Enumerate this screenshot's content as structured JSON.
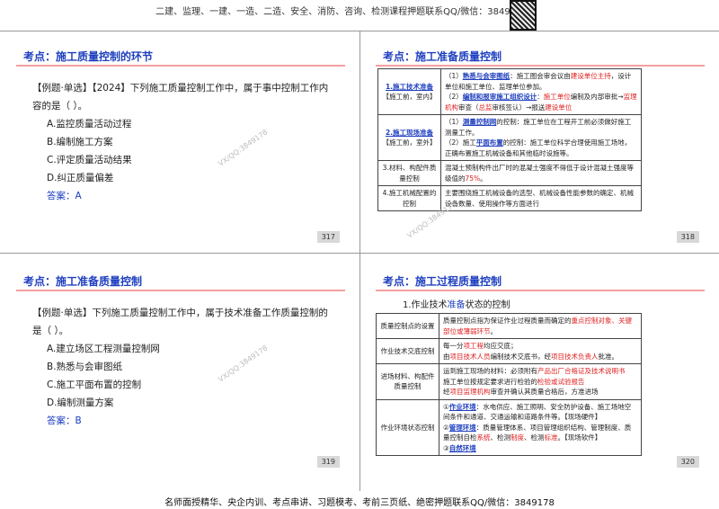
{
  "header": "二建、监理、一建、一造、二造、安全、消防、咨询、检测课程押题联系QQ/微信：3849178",
  "footer": "名师面授精华、央企内训、考点串讲、习题模考、考前三页纸、绝密押题联系QQ/微信：3849178",
  "watermark": "VX/QQ:3849178",
  "s317": {
    "title": "考点：施工质量控制的环节",
    "question": "【例题·单选】【2024】下列施工质量控制工作中，属于事中控制工作内容的是（   ）。",
    "options": [
      "A.监控质量活动过程",
      "B.编制施工方案",
      "C.评定质量活动结果",
      "D.纠正质量偏差"
    ],
    "answer": "答案：A",
    "page": "317"
  },
  "s318": {
    "title": "考点：施工准备质量控制",
    "page": "318",
    "r1h": "1.施工技术准备",
    "r1s": "【施工前，室内】",
    "r1a": "（1）",
    "r1b": "熟悉与会审图纸",
    "r1c": "：施工图会审会议由",
    "r1d": "建设单位主持",
    "r1e": "，设计单位和施工单位、监理单位参加。",
    "r1f": "（2）",
    "r1g": "编制和报审施工组织设计",
    "r1h2": "：",
    "r1i": "施工单位",
    "r1j": "编制及内部审批→",
    "r1k": "监理机构",
    "r1l": "审查（",
    "r1m": "总监",
    "r1n": "审核签认）→报送",
    "r1o": "建设单位",
    "r2h": "2.施工现场准备",
    "r2s": "【施工前，室外】",
    "r2a": "（1）",
    "r2b": "测量控制网",
    "r2c": "的控制：施工单位在工程开工前必须做好施工测量工作。",
    "r2d": "（2）施工",
    "r2e": "平面布置",
    "r2f": "的控制：施工单位科学合理使用施工场地，正确布置施工机械设备和其他临时设施等。",
    "r3h": "3.材料、构配件质量控制",
    "r3a": "混凝土预制构件出厂时的混凝土强度不得低于设计混凝土强度等级值的",
    "r3b": "75%",
    "r3c": "。",
    "r4h": "4.施工机械配置的控制",
    "r4a": "主要围绕施工机械设备的选型、机械设备性能参数的确定、机械设备数量、使用操作等方面进行"
  },
  "s319": {
    "title": "考点：施工准备质量控制",
    "question": "【例题·单选】下列施工质量控制工作中，属于技术准备工作质量控制的是（   ）。",
    "options": [
      "A.建立场区工程测量控制网",
      "B.熟悉与会审图纸",
      "C.施工平面布置的控制",
      "D.编制测量方案"
    ],
    "answer": "答案：B",
    "page": "319"
  },
  "s320": {
    "title": "考点：施工过程质量控制",
    "page": "320",
    "sub_a": "1.作业技术",
    "sub_b": "准备",
    "sub_c": "状态的控制",
    "r1h": "质量控制点的设置",
    "r1a": "质量控制点指为保证作业过程质量而确定的",
    "r1b": "重点控制对象、关键部位或薄弱环节",
    "r1c": "。",
    "r2h": "作业技术交底控制",
    "r2a": "每一分",
    "r2b": "项工程",
    "r2c": "均应交底；",
    "r2d": "由",
    "r2e": "项目技术人员",
    "r2f": "编制技术交底书，经",
    "r2g": "项目技术负责人",
    "r2h2": "批准。",
    "r3h": "进场材料、构配件质量控制",
    "r3a": "运到施工现场的材料：必须附有",
    "r3b": "产品出厂合格证及技术说明书",
    "r3c": "施工单位按规定要求进行检验的",
    "r3d": "检验或试验报告",
    "r3e": "经",
    "r3f": "项目监理机构",
    "r3g": "审查并确认其质量合格后，方准进场",
    "r4h": "作业环境状态控制",
    "r4a": "①",
    "r4b": "作业环境",
    "r4c": "：水电供应、施工照明、安全防护设备、施工场地空间条件和通道、交通运输和道路条件等。【现场硬件】",
    "r4d": "②",
    "r4e": "管理环境",
    "r4f": "：质量管理体系、项目管理组织结构、管理制度、质量控制自检",
    "r4g": "系统",
    "r4h2": "、检测",
    "r4i": "制度",
    "r4j": "、检测",
    "r4k": "标准",
    "r4l": "。【现场软件】",
    "r4m": "③",
    "r4n": "自然环境"
  }
}
